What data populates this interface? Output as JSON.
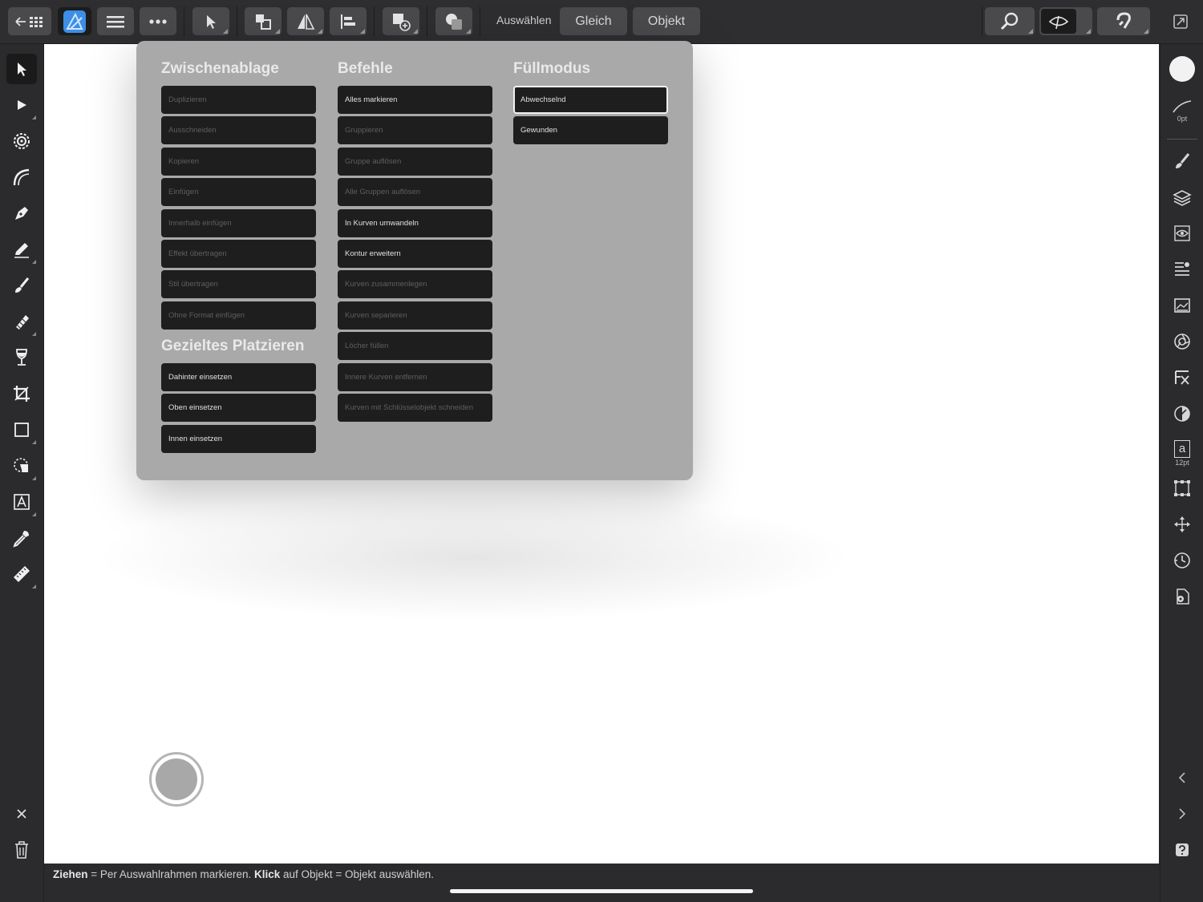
{
  "toolbar": {
    "select_label": "Auswählen",
    "same_label": "Gleich",
    "object_label": "Objekt"
  },
  "popover": {
    "clipboard": {
      "title": "Zwischenablage",
      "items": [
        {
          "label": "Duplizieren",
          "enabled": false
        },
        {
          "label": "Ausschneiden",
          "enabled": false
        },
        {
          "label": "Kopieren",
          "enabled": false
        },
        {
          "label": "Einfügen",
          "enabled": false
        },
        {
          "label": "Innerhalb einfügen",
          "enabled": false
        },
        {
          "label": "Effekt übertragen",
          "enabled": false
        },
        {
          "label": "Stil übertragen",
          "enabled": false
        },
        {
          "label": "Ohne Format einfügen",
          "enabled": false
        }
      ]
    },
    "placement": {
      "title": "Gezieltes Platzieren",
      "items": [
        {
          "label": "Dahinter einsetzen",
          "enabled": true
        },
        {
          "label": "Oben einsetzen",
          "enabled": true
        },
        {
          "label": "Innen einsetzen",
          "enabled": true
        }
      ]
    },
    "commands": {
      "title": "Befehle",
      "items": [
        {
          "label": "Alles markieren",
          "enabled": true
        },
        {
          "label": "Gruppieren",
          "enabled": false
        },
        {
          "label": "Gruppe auflösen",
          "enabled": false
        },
        {
          "label": "Alle Gruppen auflösen",
          "enabled": false
        },
        {
          "label": "In Kurven umwandeln",
          "enabled": true
        },
        {
          "label": "Kontur erweitern",
          "enabled": true
        },
        {
          "label": "Kurven zusammenlegen",
          "enabled": false
        },
        {
          "label": "Kurven separieren",
          "enabled": false
        },
        {
          "label": "Löcher füllen",
          "enabled": false
        },
        {
          "label": "Innere Kurven entfernen",
          "enabled": false
        },
        {
          "label": "Kurven mit Schlüsselobjekt schneiden",
          "enabled": false
        }
      ]
    },
    "fillmode": {
      "title": "Füllmodus",
      "items": [
        {
          "label": "Abwechselnd",
          "enabled": true,
          "selected": true
        },
        {
          "label": "Gewunden",
          "enabled": true,
          "selected": false
        }
      ]
    }
  },
  "right_panel": {
    "stroke_width": "0pt",
    "font_size": "12pt",
    "char_glyph": "a"
  },
  "status": {
    "drag_bold": "Ziehen",
    "drag_text": " = Per Auswahlrahmen markieren. ",
    "click_bold": "Klick",
    "click_text": " auf Objekt = Objekt auswählen."
  },
  "colors": {
    "toolbar_bg": "#2e2e30",
    "button_bg": "#4a4a4c",
    "popover_bg": "#a9a9a9",
    "menu_button_bg": "#1e1e1f",
    "app_accent": "#3d8ee6"
  }
}
